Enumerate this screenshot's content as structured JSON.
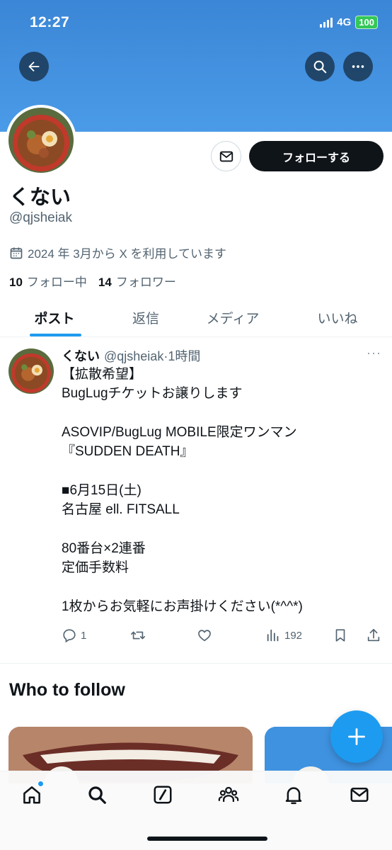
{
  "status_bar": {
    "time": "12:27",
    "network": "4G",
    "battery": "100"
  },
  "profile": {
    "display_name": "くない",
    "handle": "@qjsheiak",
    "joined": "2024 年 3月から X を利用しています",
    "following_count": "10",
    "following_label": "フォロー中",
    "followers_count": "14",
    "followers_label": "フォロワー",
    "follow_button": "フォローする"
  },
  "tabs": [
    {
      "label": "ポスト",
      "active": true
    },
    {
      "label": "返信",
      "active": false
    },
    {
      "label": "メディア",
      "active": false
    },
    {
      "label": "いいね",
      "active": false
    }
  ],
  "post": {
    "name": "くない",
    "handle": "@qjsheiak",
    "time": "·1時間",
    "more": "···",
    "text": "【拡散希望】\nBugLugチケットお譲りします\n\nASOVIP/BugLug MOBILE限定ワンマン\n『SUDDEN DEATH』\n\n■6月15日(土)\n名古屋 ell. FITSALL\n\n80番台×2連番\n定価手数料\n\n1枚からお気軽にお声掛けください(*^^*)",
    "replies": "1",
    "views": "192"
  },
  "who_to_follow": {
    "title": "Who to follow"
  },
  "colors": {
    "accent": "#1d9bf0",
    "banner": "#4a9be8",
    "text": "#0f1419",
    "muted": "#536471"
  },
  "icons": [
    "back-arrow-icon",
    "search-icon",
    "more-icon",
    "mail-icon",
    "calendar-icon",
    "reply-icon",
    "repost-icon",
    "like-icon",
    "views-icon",
    "bookmark-icon",
    "share-icon",
    "plus-icon",
    "home-icon",
    "explore-icon",
    "grok-icon",
    "communities-icon",
    "notifications-icon",
    "messages-icon"
  ]
}
